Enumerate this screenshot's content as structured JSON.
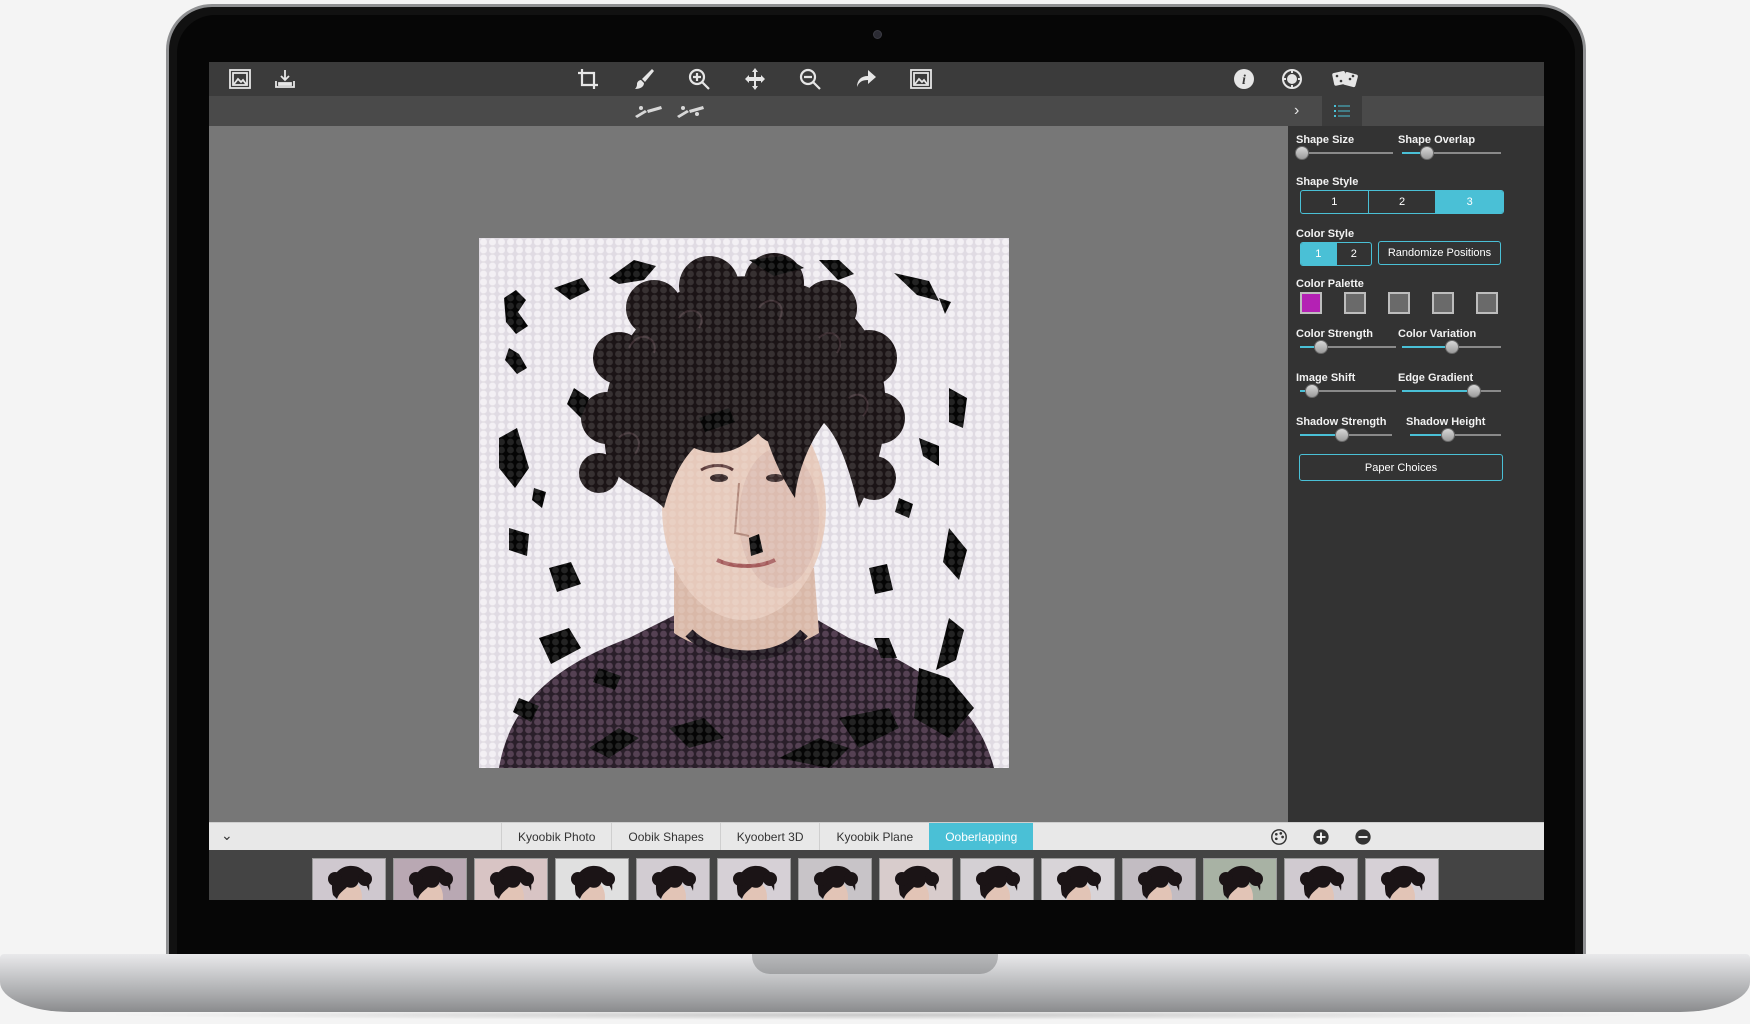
{
  "toolbar": {
    "left_icons": [
      "open-image-icon",
      "save-image-icon"
    ],
    "center_icons": [
      "crop-icon",
      "brush-icon",
      "zoom-in-icon",
      "pan-icon",
      "zoom-out-icon",
      "redo-icon",
      "fit-image-icon"
    ],
    "right_icons": [
      "info-icon",
      "settings-icon",
      "random-dice-icon"
    ]
  },
  "panel": {
    "shape_size": {
      "label": "Shape Size",
      "value": 0.02
    },
    "shape_overlap": {
      "label": "Shape Overlap",
      "value": 0.25
    },
    "shape_style": {
      "label": "Shape Style",
      "options": [
        "1",
        "2",
        "3"
      ],
      "selected": "3"
    },
    "color_style": {
      "label": "Color Style",
      "options": [
        "1",
        "2"
      ],
      "selected": "1"
    },
    "randomize_label": "Randomize Positions",
    "color_palette": {
      "label": "Color Palette",
      "swatches": [
        "#b421b4",
        "#6a6a6a",
        "#6a6a6a",
        "#6a6a6a",
        "#6a6a6a"
      ]
    },
    "color_strength": {
      "label": "Color Strength",
      "value": 0.22
    },
    "color_variation": {
      "label": "Color Variation",
      "value": 0.5
    },
    "image_shift": {
      "label": "Image Shift",
      "value": 0.12
    },
    "edge_gradient": {
      "label": "Edge Gradient",
      "value": 0.73
    },
    "shadow_strength": {
      "label": "Shadow Strength",
      "value": 0.46
    },
    "shadow_height": {
      "label": "Shadow Height",
      "value": 0.42
    },
    "paper_choices_label": "Paper Choices"
  },
  "tabs": {
    "items": [
      "Kyoobik Photo",
      "Oobik Shapes",
      "Kyoobert 3D",
      "Kyoobik Plane",
      "Ooberlapping"
    ],
    "active": "Ooberlapping"
  },
  "thumbnails": [
    "Ooberlapping-01",
    "Ooberlapping-02",
    "Ooberlapping-03",
    "Ooberlapping-04",
    "Ooberlapping-05",
    "Ooberlapping-06",
    "Ooberlapping-07",
    "Ooberlapping-08",
    "Ooberlapping-09",
    "Ooberlapping-10",
    "Ooberlapping-11",
    "Ooberlapping-12",
    "Ooberlapping-13",
    "Ooberlapping-14"
  ],
  "colors": {
    "accent": "#4ac0d6",
    "panel": "#333333",
    "toolbar": "#3b3b3b"
  }
}
